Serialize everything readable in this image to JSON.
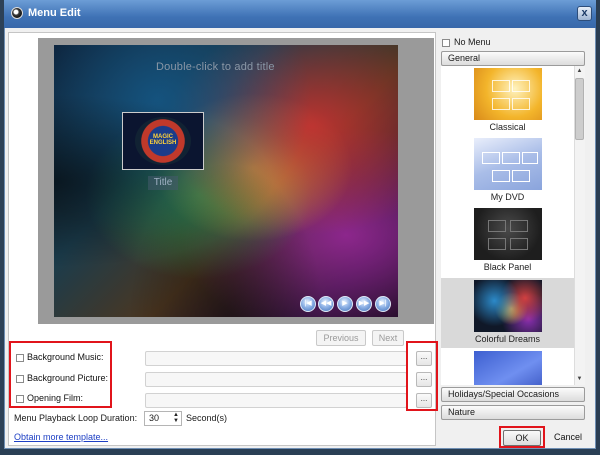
{
  "window": {
    "title": "Menu Edit",
    "close_glyph": "x"
  },
  "preview": {
    "title_hint": "Double-click to add title",
    "thumb_logo_text": "MAGIC ENGLISH",
    "title_label": "Title",
    "controls": [
      "first",
      "prev",
      "play",
      "next",
      "last"
    ]
  },
  "pager": {
    "previous": "Previous",
    "next": "Next"
  },
  "fields": [
    {
      "label": "Background Music:",
      "checked": false,
      "value": ""
    },
    {
      "label": "Background Picture:",
      "checked": false,
      "value": ""
    },
    {
      "label": "Opening Film:",
      "checked": false,
      "value": ""
    }
  ],
  "browse_label": "...",
  "loop": {
    "label": "Menu Playback Loop Duration:",
    "value": "30",
    "unit": "Second(s)"
  },
  "obtain_link": "Obtain more template...",
  "sidebar": {
    "no_menu_label": "No Menu",
    "categories": [
      "General",
      "Holidays/Special Occasions",
      "Nature"
    ],
    "templates": [
      {
        "label": "Classical"
      },
      {
        "label": "My DVD"
      },
      {
        "label": "Black Panel"
      },
      {
        "label": "Colorful Dreams"
      },
      {
        "label": ""
      }
    ]
  },
  "buttons": {
    "ok": "OK",
    "cancel": "Cancel"
  },
  "colors": {
    "title_bar": "#3f72b5",
    "highlight_red": "#e1141b",
    "link": "#1d3fc4",
    "selected_template": "#d9d9d9"
  }
}
